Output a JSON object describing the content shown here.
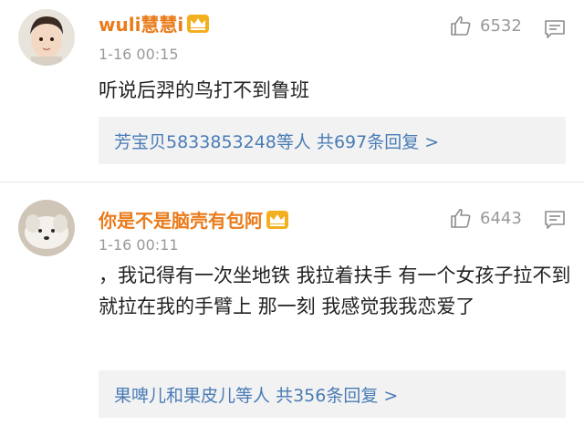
{
  "comments": [
    {
      "username": "wuli慧慧i",
      "time": "1-16 00:15",
      "likes": "6532",
      "text": "听说后羿的鸟打不到鲁班",
      "reply_users": "芳宝贝5833853248等人",
      "reply_count": "共697条回复",
      "reply_arrow": ">"
    },
    {
      "username": "你是不是脑壳有包阿",
      "time": "1-16 00:11",
      "likes": "6443",
      "text": "，我记得有一次坐地铁 我拉着扶手 有一个女孩子拉不到 就拉在我的手臂上 那一刻 我感觉我我恋爱了",
      "reply_users": "果啤儿和果皮儿等人",
      "reply_count": "共356条回复",
      "reply_arrow": ">"
    }
  ],
  "colors": {
    "username": "#ea7b1a",
    "time": "#999999",
    "reply_link": "#4a7cb6",
    "reply_bg": "#f2f2f2",
    "crown": "#f2b01e"
  },
  "icons": {
    "like": "thumbs-up-icon",
    "more": "comment-reply-icon",
    "badge": "vip-crown-icon"
  }
}
